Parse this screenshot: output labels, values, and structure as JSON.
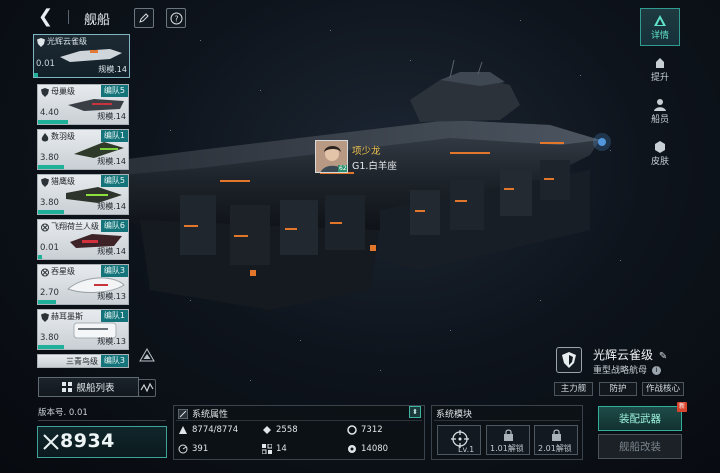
{
  "header": {
    "title": "舰船"
  },
  "ship_list": {
    "items": [
      {
        "name": "光辉云雀级",
        "value": "0.01",
        "scale": "规模.14",
        "fleet": "",
        "selected": true
      },
      {
        "name": "母巢级",
        "value": "4.40",
        "scale": "规模.14",
        "fleet": "编队5"
      },
      {
        "name": "数羽级",
        "value": "3.80",
        "scale": "规模.14",
        "fleet": "编队1"
      },
      {
        "name": "猎鹰级",
        "value": "3.80",
        "scale": "规模.14",
        "fleet": "编队5"
      },
      {
        "name": "飞翔荷兰人级",
        "value": "0.01",
        "scale": "规模.14",
        "fleet": "编队6"
      },
      {
        "name": "吞星级",
        "value": "2.70",
        "scale": "规模.13",
        "fleet": "编队3"
      },
      {
        "name": "赫耳墨斯",
        "value": "3.80",
        "scale": "规模.13",
        "fleet": "编队1"
      },
      {
        "name": "三青鸟级",
        "value": "",
        "scale": "",
        "fleet": "编队3"
      }
    ],
    "list_button": "舰船列表"
  },
  "side_nav": [
    {
      "label": "详情",
      "icon": "details-icon",
      "active": true
    },
    {
      "label": "提升",
      "icon": "upgrade-icon"
    },
    {
      "label": "船员",
      "icon": "crew-icon"
    },
    {
      "label": "皮肤",
      "icon": "skin-icon"
    }
  ],
  "captain": {
    "name": "项少龙",
    "rank": "G1.白羊座",
    "level_badge": "62"
  },
  "ship": {
    "name": "光辉云雀级",
    "class": "重型战略航母",
    "tags": [
      "主力舰",
      "防护",
      "作战核心"
    ]
  },
  "footer": {
    "version": "版本号. 0.01",
    "power": "8934",
    "attributes_title": "系统属性",
    "attributes": [
      {
        "icon": "hull-icon",
        "value": "8774/8774"
      },
      {
        "icon": "armor-icon",
        "value": "2558"
      },
      {
        "icon": "shield-stat-icon",
        "value": "7312"
      },
      {
        "icon": "speed-icon",
        "value": "391"
      },
      {
        "icon": "grid-icon",
        "value": "14"
      },
      {
        "icon": "energy-icon",
        "value": "14080"
      }
    ],
    "modules_title": "系统模块",
    "modules": [
      {
        "label": "Lv.1",
        "locked": false
      },
      {
        "label": "1.01解锁",
        "locked": true
      },
      {
        "label": "2.01解锁",
        "locked": true
      }
    ],
    "equip_button": "装配武器",
    "refit_button": "舰船改装",
    "new_badge": "新"
  },
  "colors": {
    "accent": "#2fae9a",
    "fleet_tag": "#15747a",
    "captain_name": "#f1c24e"
  }
}
